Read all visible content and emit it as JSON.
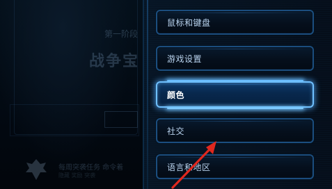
{
  "background": {
    "subtitle": "第一阶段",
    "title": "战争宝",
    "mission_line_1": "每周突袭任务 命令着",
    "mission_line_2": "隐藏 奖励 突袭"
  },
  "menu": {
    "items": [
      {
        "label": "鼠标和键盘",
        "selected": false
      },
      {
        "label": "游戏设置",
        "selected": false
      },
      {
        "label": "颜色",
        "selected": true
      },
      {
        "label": "社交",
        "selected": false
      },
      {
        "label": "语言和地区",
        "selected": false
      }
    ]
  },
  "colors": {
    "accent": "#6fc0ff",
    "border": "#1b4d7e",
    "annotation": "#e0281e"
  }
}
